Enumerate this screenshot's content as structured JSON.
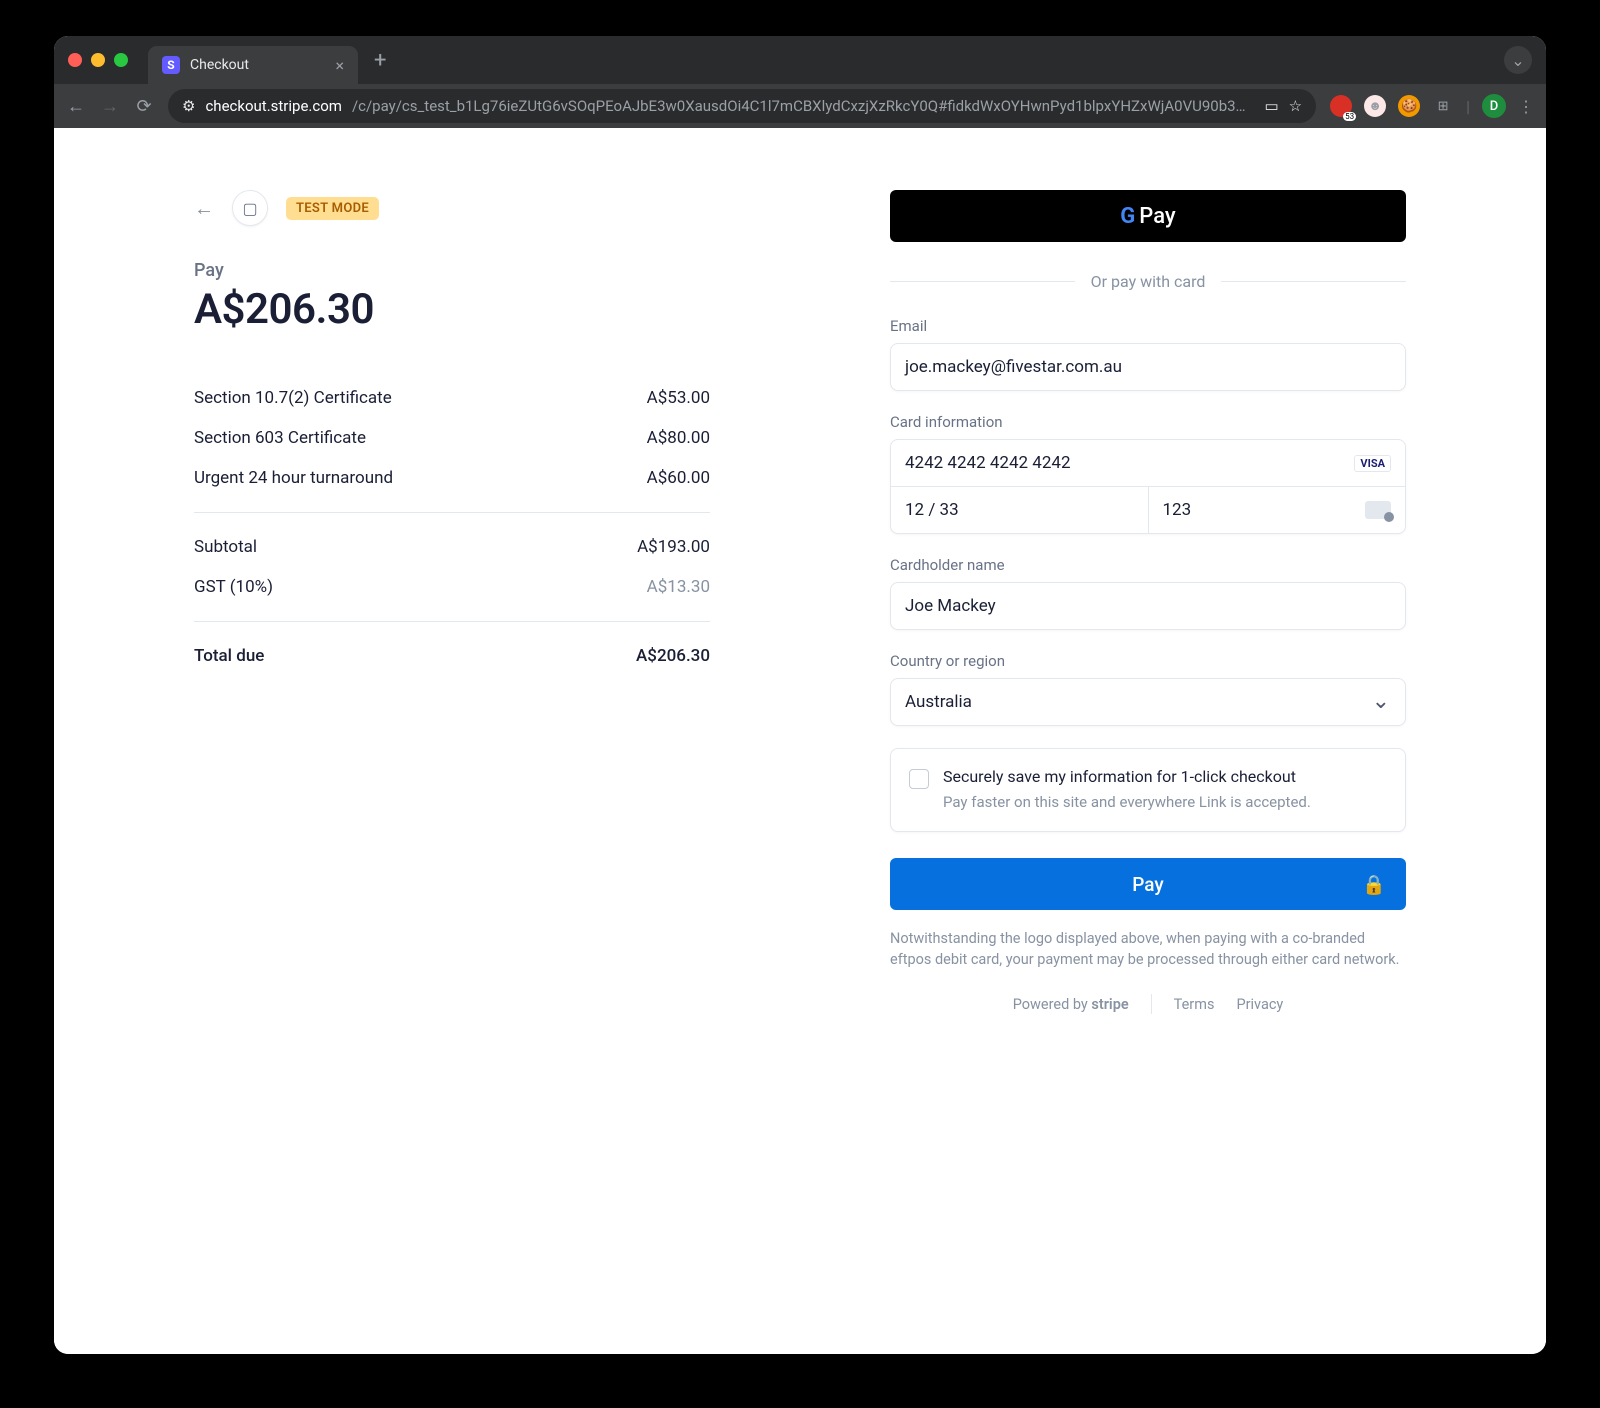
{
  "browser": {
    "tab_title": "Checkout",
    "url_domain": "checkout.stripe.com",
    "url_path": "/c/pay/cs_test_b1Lg76ieZUtG6vSOqPEoAJbE3w0XausdOi4C1l7mCBXlydCxzjXzRkcY0Q#fidkdWxOYHwnPyd1blpxYHZxWjA0VU90b3…",
    "avatar_letter": "D"
  },
  "left": {
    "test_mode": "TEST MODE",
    "pay_label": "Pay",
    "amount": "A$206.30",
    "items": [
      {
        "label": "Section 10.7(2) Certificate",
        "price": "A$53.00"
      },
      {
        "label": "Section 603 Certificate",
        "price": "A$80.00"
      },
      {
        "label": "Urgent 24 hour turnaround",
        "price": "A$60.00"
      }
    ],
    "subtotal_label": "Subtotal",
    "subtotal_value": "A$193.00",
    "tax_label": "GST (10%)",
    "tax_value": "A$13.30",
    "total_label": "Total due",
    "total_value": "A$206.30"
  },
  "right": {
    "gpay_label": "Pay",
    "or_label": "Or pay with card",
    "email_label": "Email",
    "email_value": "joe.mackey@fivestar.com.au",
    "card_label": "Card information",
    "card_number": "4242 4242 4242 4242",
    "card_brand": "VISA",
    "card_expiry": "12 / 33",
    "card_cvc": "123",
    "name_label": "Cardholder name",
    "name_value": "Joe Mackey",
    "country_label": "Country or region",
    "country_value": "Australia",
    "save_title": "Securely save my information for 1-click checkout",
    "save_sub": "Pay faster on this site and everywhere Link is accepted.",
    "pay_button": "Pay",
    "disclaimer": "Notwithstanding the logo displayed above, when paying with a co-branded eftpos debit card, your payment may be processed through either card network.",
    "powered_by": "Powered by",
    "stripe_word": "stripe",
    "terms": "Terms",
    "privacy": "Privacy"
  }
}
